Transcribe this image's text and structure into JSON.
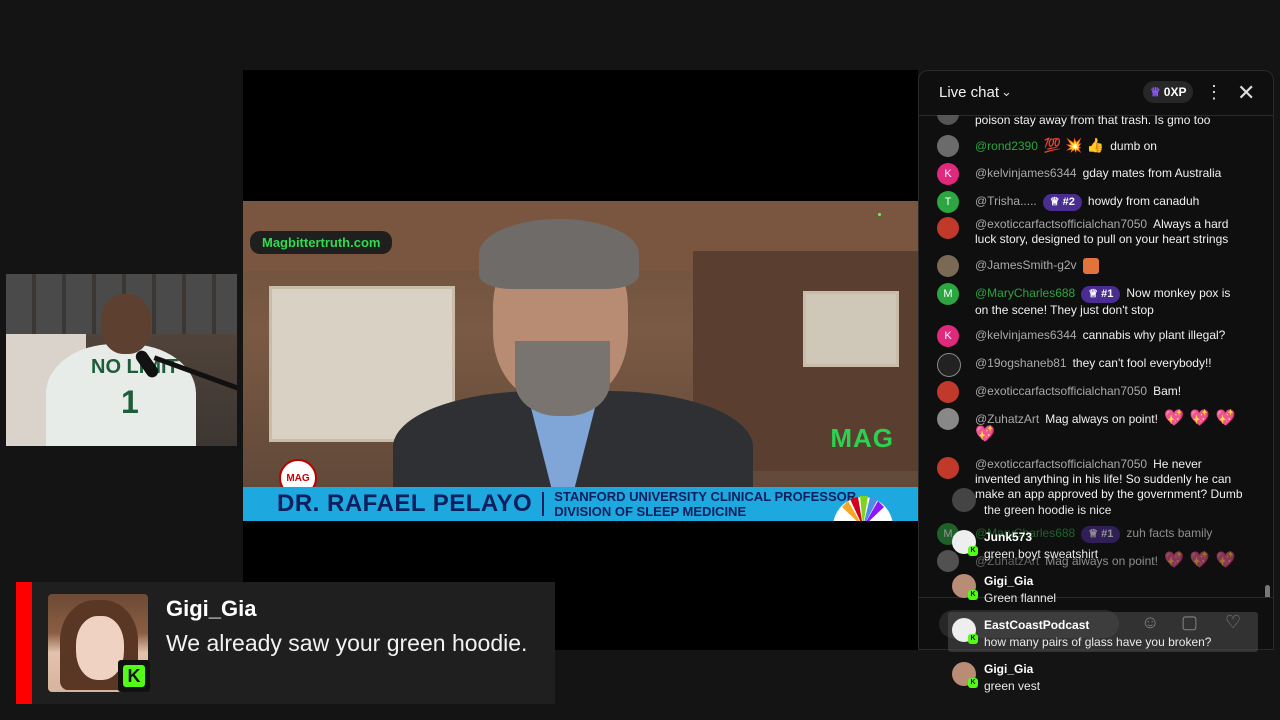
{
  "video": {
    "url_badge": "Magbittertruth.com",
    "mag_logo": "MAG",
    "mag_small": "MAG",
    "lower_third_name": "DR. RAFAEL PELAYO",
    "lower_third_title_1": "STANFORD UNIVERSITY CLINICAL PROFESSOR,",
    "lower_third_title_2": "DIVISION OF SLEEP MEDICINE"
  },
  "webcam": {
    "shirt_text": "NO LIMIT",
    "shirt_number": "1"
  },
  "alert": {
    "accent_color": "#ff0000",
    "username": "Gigi_Gia",
    "message": "We already saw your green hoodie.",
    "badge_letter": "K"
  },
  "chat": {
    "title": "Live chat",
    "xp_label": "0XP",
    "messages": [
      {
        "author": "",
        "text": "poison stay away from that trash. Is gmo too",
        "avatar_color": "#555",
        "avatar_letter": ""
      },
      {
        "author": "@rond2390",
        "text": "dumb on",
        "avatar_color": "#6b6b6b",
        "avatar_letter": "",
        "member": true,
        "emojis": [
          "💯",
          "💥",
          "👍"
        ]
      },
      {
        "author": "@kelvinjames6344",
        "text": "gday mates from Australia",
        "avatar_color": "#e0287c",
        "avatar_letter": "K"
      },
      {
        "author": "@Trisha.....",
        "text": "howdy from canaduh",
        "avatar_color": "#2ba640",
        "avatar_letter": "T",
        "rank": "#2"
      },
      {
        "author": "@exoticcarfactsofficialchan7050",
        "text": "Always a hard luck story, designed to pull on your heart strings",
        "avatar_color": "#c0392b",
        "avatar_letter": ""
      },
      {
        "author": "@JamesSmith-g2v",
        "text": "",
        "avatar_color": "#7a6a55",
        "avatar_letter": ""
      },
      {
        "author": "@MaryCharles688",
        "text": "Now monkey pox is on the scene! They just don't stop",
        "avatar_color": "#2ba640",
        "avatar_letter": "M",
        "member": true,
        "rank": "#1"
      },
      {
        "author": "@kelvinjames6344",
        "text": "cannabis why plant illegal?",
        "avatar_color": "#e0287c",
        "avatar_letter": "K"
      },
      {
        "author": "@19ogshaneb81",
        "text": "they can't fool everybody!!",
        "avatar_color": "#222",
        "avatar_letter": ""
      },
      {
        "author": "@exoticcarfactsofficialchan7050",
        "text": "Bam!",
        "avatar_color": "#c0392b",
        "avatar_letter": ""
      },
      {
        "author": "@ZuhatzArt",
        "text": "Mag always on point!",
        "avatar_color": "#888",
        "avatar_letter": ""
      },
      {
        "author": "@exoticcarfactsofficialchan7050",
        "text": "He never invented anything in his life! So suddenly he can make an app approved by the government? Dumb",
        "avatar_color": "#c0392b",
        "avatar_letter": ""
      },
      {
        "author": "@MaryCharles688",
        "text": "zuh facts bamily",
        "avatar_color": "#2ba640",
        "avatar_letter": "M",
        "member": true,
        "rank": "#1"
      },
      {
        "author": "@ZuhatzArt",
        "text": "Mag always on point!",
        "avatar_color": "#888",
        "avatar_letter": ""
      }
    ]
  },
  "kick_overlay": [
    {
      "name": "",
      "text": "the green hoodie is nice"
    },
    {
      "name": "Junk573",
      "text": "green boyt sweatshirt"
    },
    {
      "name": "Gigi_Gia",
      "text": "Green flannel"
    },
    {
      "name": "EastCoastPodcast",
      "text": "how many pairs of glass have you broken?"
    },
    {
      "name": "Gigi_Gia",
      "text": "green vest"
    }
  ]
}
